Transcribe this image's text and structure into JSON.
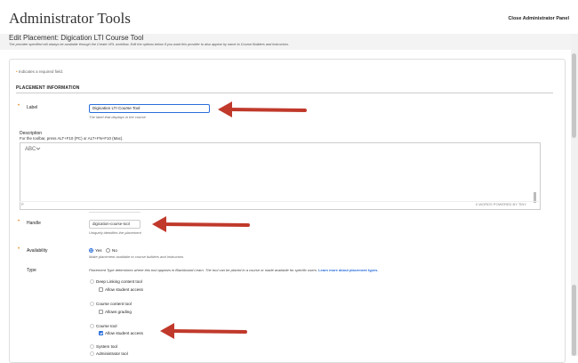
{
  "header": {
    "app_title": "Administrator Tools",
    "close_link": "Close Administrator Panel"
  },
  "page": {
    "title": "Edit Placement: Digication LTI Course Tool",
    "subtitle": "The provider specified will always be available through the Create URL workflow. Edit the options below if you want this provider to also appear by name to Course Builders and Instructors."
  },
  "form": {
    "required_note": "Indicates a required field.",
    "required_star": "•",
    "section_title": "PLACEMENT INFORMATION",
    "label": {
      "label": "Label",
      "value": "Digication LTI Course Tool",
      "hint": "The label that displays in the course"
    },
    "description": {
      "label": "Description",
      "help": "For the toolbar, press ALT+F10 (PC) or ALT+FN+F10 (Mac).",
      "toolbar_icon": "spellcheck-icon",
      "status_path": "P",
      "status_words": "0 WORDS  POWERED BY TINY"
    },
    "handle": {
      "label": "Handle",
      "value": "digication-course-tool",
      "hint": "Uniquely identifies the placement"
    },
    "availability": {
      "label": "Availability",
      "options": [
        "Yes",
        "No"
      ],
      "selected": "Yes",
      "hint": "Make placement available to course builders and instructors"
    },
    "type": {
      "label": "Type",
      "description": "Placement Type determines where this tool appears in Blackboard Learn. The tool can be placed in a course or made available for specific users.",
      "learn_more": "Learn more about placement types.",
      "options": [
        {
          "label": "Deep Linking content tool",
          "sub_label": "Allow student access",
          "sub_checked": false
        },
        {
          "label": "Course content tool",
          "sub_label": "Allows grading",
          "sub_checked": false
        },
        {
          "label": "Course tool",
          "sub_label": "Allow student access",
          "sub_checked": true
        },
        {
          "label": "System tool"
        },
        {
          "label": "Administrator tool"
        }
      ],
      "selected": "Course tool"
    }
  },
  "colors": {
    "accent": "#2a6fdb",
    "required": "#e98a1a",
    "annotation_arrow": "#c0392b"
  }
}
